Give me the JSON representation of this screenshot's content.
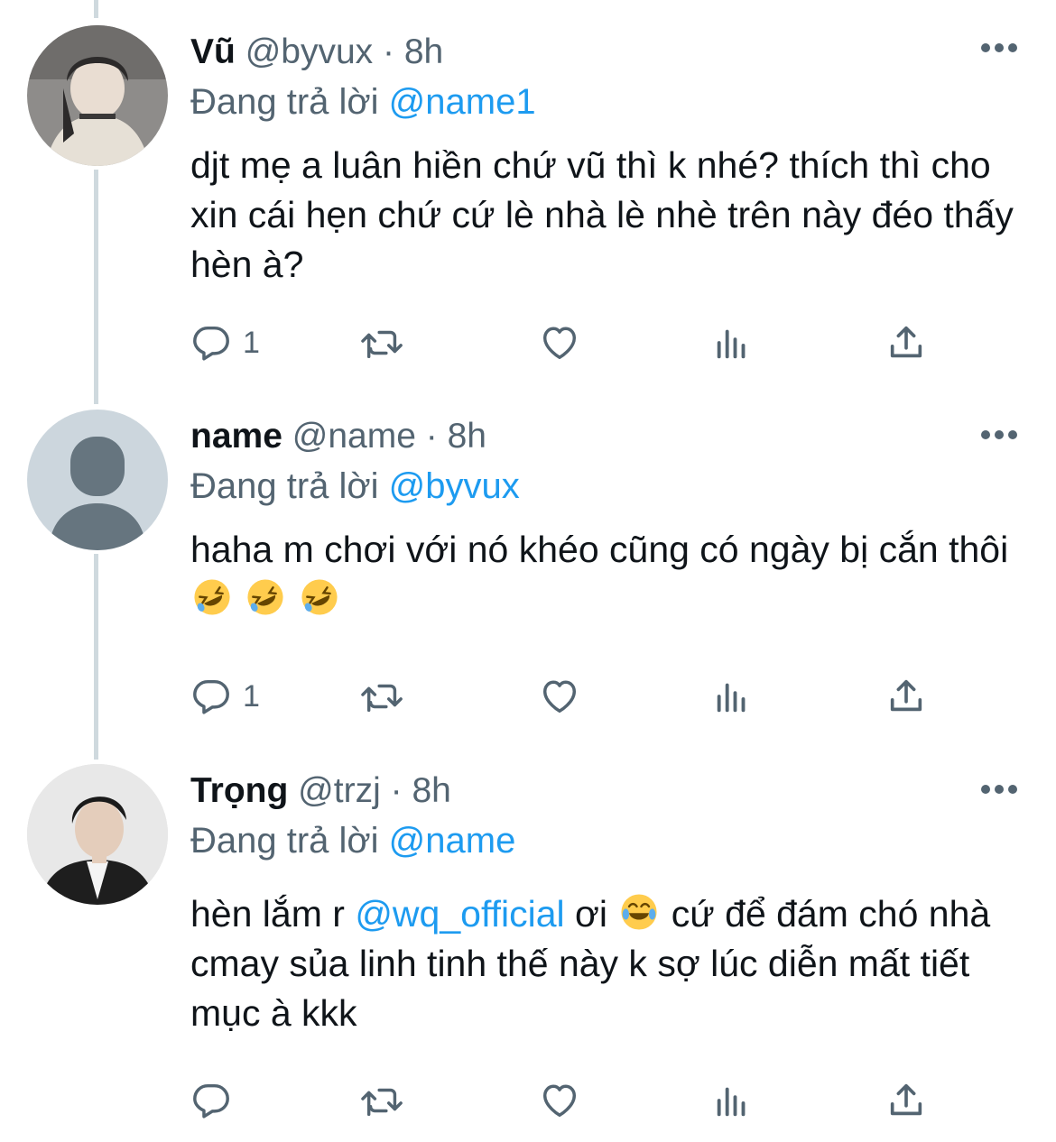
{
  "tweets": [
    {
      "display_name": "Vũ",
      "handle": "@byvux",
      "separator": "·",
      "time": "8h",
      "replying_prefix": "Đang trả lời",
      "replying_to": "@name1",
      "text": "djt mẹ a luân hiền chứ vũ thì k nhé? thích thì cho xin cái hẹn chứ cứ lè nhà lè nhè trên này đéo thấy hèn à?",
      "reply_count": "1"
    },
    {
      "display_name": "name",
      "handle": "@name",
      "separator": "·",
      "time": "8h",
      "replying_prefix": "Đang trả lời",
      "replying_to": "@byvux",
      "text": "haha m chơi với nó khéo cũng có ngày bị cắn thôi",
      "reply_count": "1"
    },
    {
      "display_name": "Trọng",
      "handle": "@trzj",
      "separator": "·",
      "time": "8h",
      "replying_prefix": "Đang trả lời",
      "replying_to": "@name",
      "text_before": "hèn lắm r ",
      "text_mention": "@wq_official",
      "text_middle": " ơi ",
      "text_after": " cứ để đám chó nhà cmay sủa linh tinh thế này k sợ lúc diễn mất tiết mục à kkk",
      "reply_count": ""
    }
  ],
  "icons": {
    "reply": "reply-icon",
    "retweet": "retweet-icon",
    "like": "like-icon",
    "views": "views-icon",
    "share": "share-icon",
    "more": "more-icon"
  },
  "colors": {
    "text": "#0f1419",
    "secondary": "#536471",
    "accent": "#1d9bf0",
    "thread_line": "#cfd9de"
  }
}
